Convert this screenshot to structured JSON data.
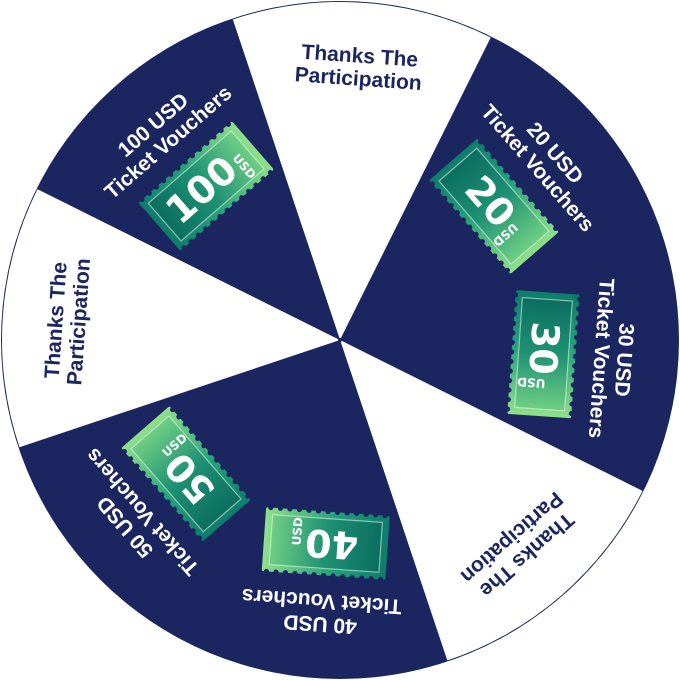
{
  "wheel": {
    "colors": {
      "navy": "#1b2660",
      "white": "#ffffff",
      "ticket_dark": "#0e7c6b",
      "ticket_mid": "#27a27c",
      "ticket_light": "#8fe08a"
    },
    "segments": [
      {
        "id": "thanks-top",
        "type": "thanks",
        "line1": "Thanks The",
        "line2": "Participation"
      },
      {
        "id": "prize-20",
        "type": "prize",
        "line1": "20 USD",
        "line2": "Ticket Vouchers",
        "amount": "20",
        "unit": "USD"
      },
      {
        "id": "prize-30",
        "type": "prize",
        "line1": "30 USD",
        "line2": "Ticket Vouchers",
        "amount": "30",
        "unit": "USD"
      },
      {
        "id": "thanks-right",
        "type": "thanks",
        "line1": "Thanks The",
        "line2": "Participation"
      },
      {
        "id": "prize-40",
        "type": "prize",
        "line1": "40 USD",
        "line2": "Ticket Vouchers",
        "amount": "40",
        "unit": "USD"
      },
      {
        "id": "prize-50",
        "type": "prize",
        "line1": "50 USD",
        "line2": "Ticket Vouchers",
        "amount": "50",
        "unit": "USD"
      },
      {
        "id": "thanks-left",
        "type": "thanks",
        "line1": "Thanks The",
        "line2": "Participation"
      },
      {
        "id": "prize-100",
        "type": "prize",
        "line1": "100 USD",
        "line2": "Ticket Vouchers",
        "amount": "100",
        "unit": "USD"
      }
    ]
  }
}
